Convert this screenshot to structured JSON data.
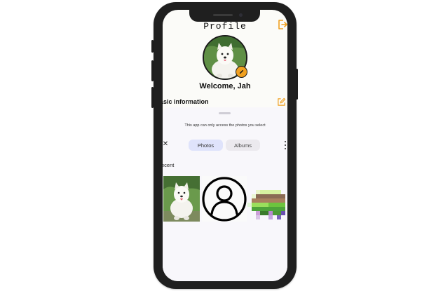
{
  "profile": {
    "title": "Profile",
    "welcome": "Welcome, Jah",
    "section_title": "asic information"
  },
  "picker": {
    "notice": "This app can only access the photos you select",
    "close_label": "✕",
    "tabs": [
      {
        "label": "Photos",
        "selected": true
      },
      {
        "label": "Albums",
        "selected": false
      }
    ],
    "recent_label": "ecent",
    "thumbnails": [
      "dog-photo",
      "person-placeholder-icon",
      "pixel-art-image"
    ]
  },
  "icons": {
    "logout": "logout-icon",
    "avatar_edit": "pencil-icon",
    "section_edit": "edit-icon",
    "more": "more-vertical-icon"
  },
  "colors": {
    "accent_orange": "#f0a020",
    "photos_tab_bg": "#dfe3fb",
    "albums_tab_bg": "#ebe9ee",
    "sheet_bg": "#f8f7fb",
    "phone_frame": "#1f1f1f"
  }
}
